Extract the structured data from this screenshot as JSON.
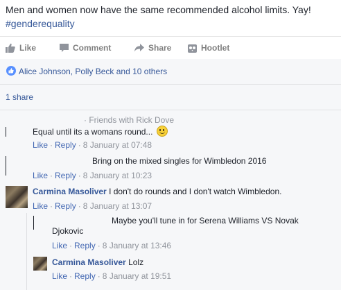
{
  "post": {
    "text": "Men and women now have the same recommended alcohol limits. Yay!",
    "hashtag": "#genderequality"
  },
  "actions": {
    "like": "Like",
    "comment": "Comment",
    "share": "Share",
    "hootlet": "Hootlet"
  },
  "likes": {
    "text": "Alice Johnson, Polly Beck and 10 others"
  },
  "shares": {
    "text": "1 share"
  },
  "comments": [
    {
      "friends_with": "· Friends with Rick Dove",
      "text": "Equal until its a womans round...",
      "like": "Like",
      "reply": "Reply",
      "time": "8 January at 07:48"
    },
    {
      "text": "Bring on the mixed singles for Wimbledon 2016",
      "like": "Like",
      "reply": "Reply",
      "time": "8 January at 10:23"
    },
    {
      "author": "Carmina Masoliver",
      "text": "I don't do rounds and I don't watch Wimbledon.",
      "like": "Like",
      "reply": "Reply",
      "time": "8 January at 13:07"
    }
  ],
  "replies": [
    {
      "text_line1": "Maybe you'll tune in for Serena Williams VS Novak",
      "text_line2": "Djokovic",
      "like": "Like",
      "reply": "Reply",
      "time": "8 January at 13:46"
    },
    {
      "author": "Carmina Masoliver",
      "text": "Lolz",
      "like": "Like",
      "reply": "Reply",
      "time": "8 January at 19:51"
    }
  ],
  "separator": "·",
  "colors": {
    "link": "#365899",
    "meta": "#90949c",
    "panel": "#f6f7f9",
    "like_badge": "#5890ff"
  },
  "icons": [
    "thumbs-up-icon",
    "comment-bubble-icon",
    "share-arrow-icon",
    "hootlet-icon",
    "like-badge-icon",
    "smiley-emoji-icon"
  ]
}
